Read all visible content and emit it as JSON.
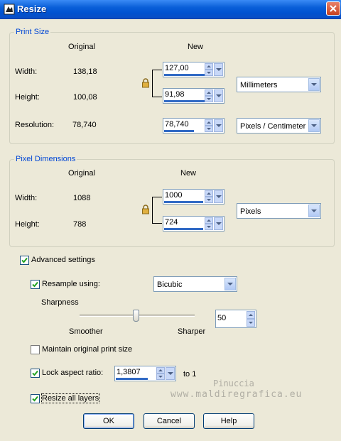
{
  "window": {
    "title": "Resize"
  },
  "print_size": {
    "title": "Print Size",
    "col_original": "Original",
    "col_new": "New",
    "width_label": "Width:",
    "width_original": "138,18",
    "width_new": "127,00",
    "height_label": "Height:",
    "height_original": "100,08",
    "height_new": "91,98",
    "resolution_label": "Resolution:",
    "resolution_original": "78,740",
    "resolution_new": "78,740",
    "units": "Millimeters",
    "resolution_units": "Pixels / Centimeter"
  },
  "pixel_dimensions": {
    "title": "Pixel Dimensions",
    "col_original": "Original",
    "col_new": "New",
    "width_label": "Width:",
    "width_original": "1088",
    "width_new": "1000",
    "height_label": "Height:",
    "height_original": "788",
    "height_new": "724",
    "units": "Pixels"
  },
  "advanced": {
    "advanced_settings_label": "Advanced settings",
    "advanced_checked": true,
    "resample_label": "Resample using:",
    "resample_checked": true,
    "resample_method": "Bicubic",
    "sharpness_label": "Sharpness",
    "sharpness_value": "50",
    "smoother_label": "Smoother",
    "sharper_label": "Sharper",
    "maintain_print_label": "Maintain original print size",
    "maintain_print_checked": false,
    "lock_aspect_label": "Lock aspect ratio:",
    "lock_aspect_checked": true,
    "aspect_value": "1,3807",
    "to_one_label": "to 1",
    "resize_layers_label": "Resize all layers",
    "resize_layers_checked": true
  },
  "buttons": {
    "ok": "OK",
    "cancel": "Cancel",
    "help": "Help"
  },
  "watermark": {
    "line1": "Pinuccia",
    "line2": "www.maldiregrafica.eu"
  },
  "colors": {
    "titlebar": "#0a5fd8",
    "group_title": "#0046d5",
    "background": "#ece9d8"
  }
}
